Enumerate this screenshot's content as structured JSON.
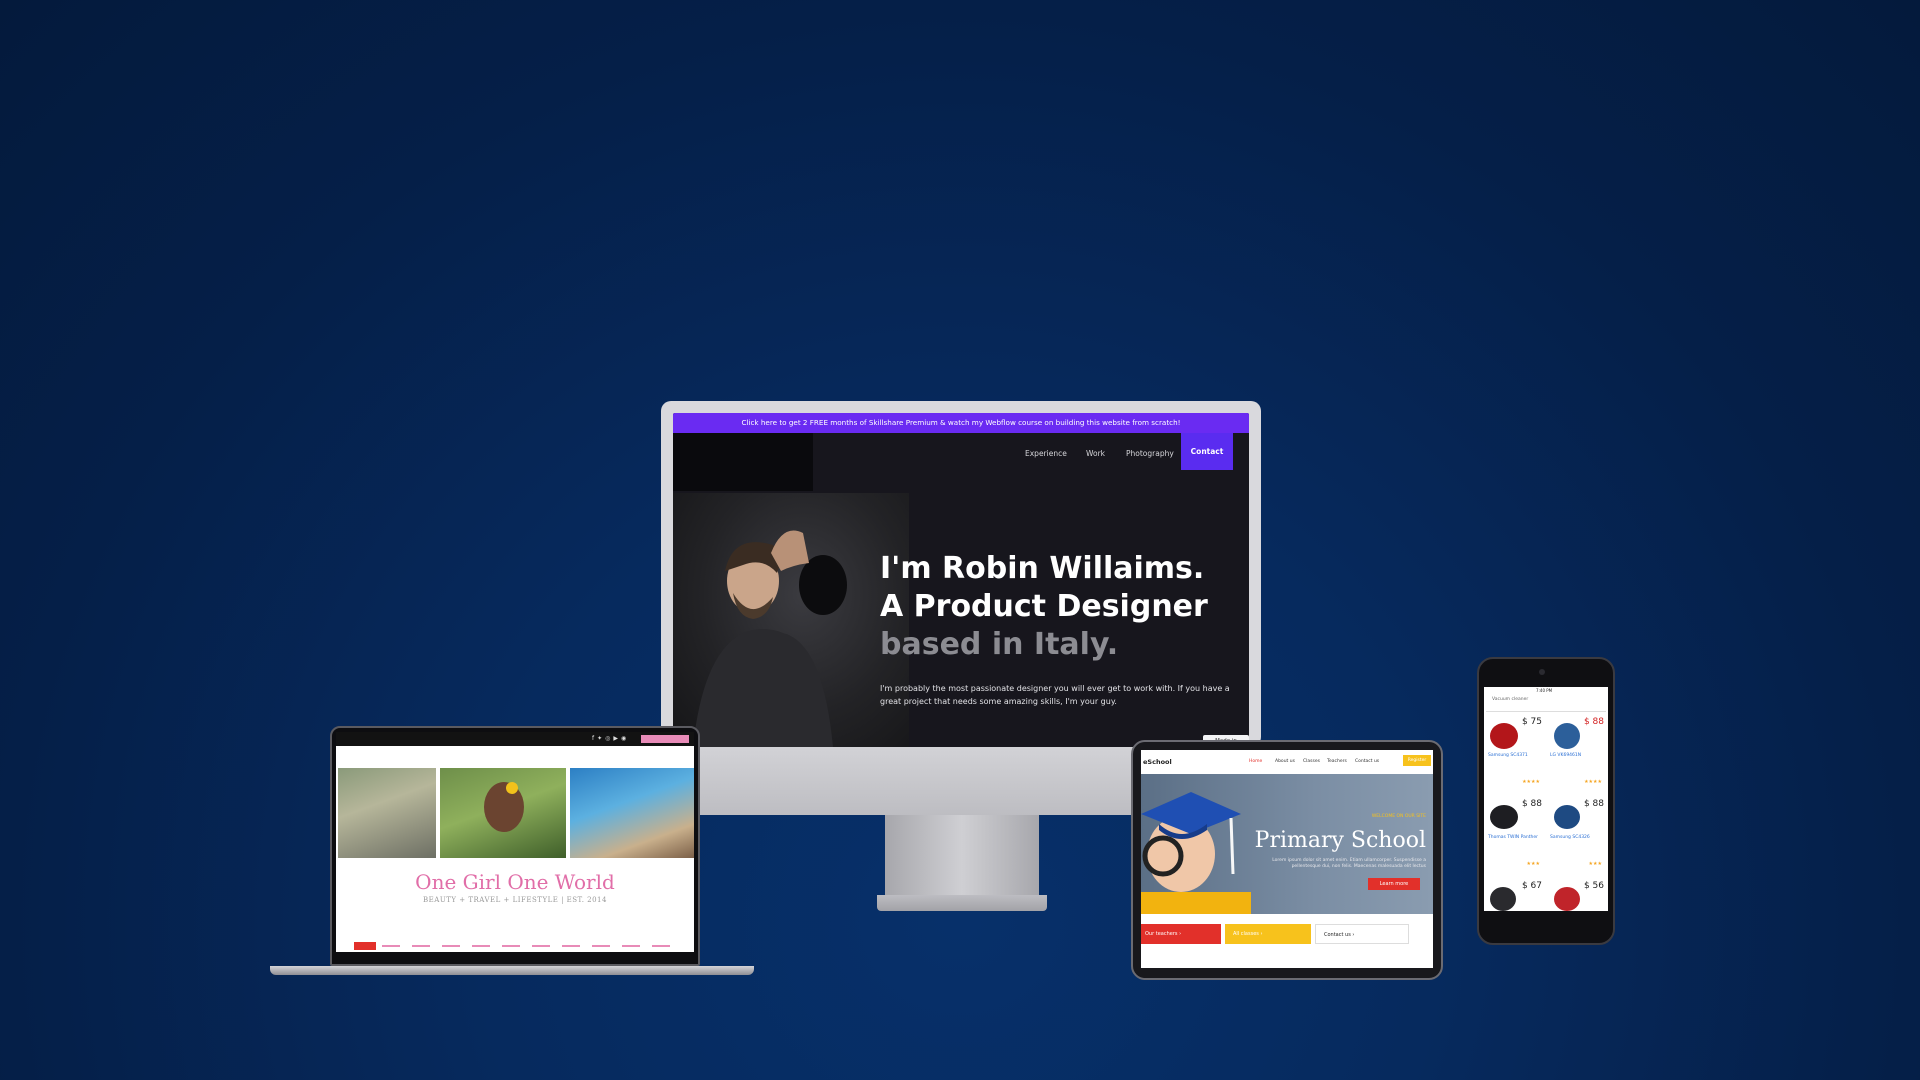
{
  "colors": {
    "background": "#051f48",
    "promo_bar": "#6a2bf2",
    "contact": "#5a2cf0",
    "blog_pink": "#e16ea8",
    "school_red": "#e2302a",
    "school_yellow": "#f7c21c"
  },
  "desktop_site": {
    "promo_banner": "Click here to get 2 FREE months of Skillshare Premium & watch my Webflow course on building this website from scratch!",
    "nav": [
      "Experience",
      "Work",
      "Photography"
    ],
    "contact_label": "Contact",
    "hero_line1": "I'm Robin Willaims.",
    "hero_line2": "A Product Designer",
    "hero_line3": "based in Italy.",
    "bio": "I'm probably the most passionate designer you will ever get to work with. If you have a great project that needs some amazing skills, I'm your guy.",
    "badge": "Made in Webflow"
  },
  "laptop_site": {
    "title": "One Girl One World",
    "subtitle": "BEAUTY + TRAVEL + LIFESTYLE | EST. 2014"
  },
  "tablet_site": {
    "logo": "eSchool",
    "nav": [
      "Home",
      "About us",
      "Classes",
      "Teachers",
      "Contact us"
    ],
    "register": "Register",
    "welcome": "WELCOME ON OUR SITE",
    "title": "Primary School",
    "body": "Lorem ipsum dolor sit amet enim. Etiam ullamcorper. Suspendisse a pellentesque dui, non felis. Maecenas malesuada elit lectus",
    "learn_more": "Learn more",
    "bottom_buttons": [
      "Our teachers",
      "All classes",
      "Contact us"
    ]
  },
  "phone_site": {
    "status_time": "7:40 PM",
    "search": "Vacuum cleaner",
    "products": [
      {
        "price": "$ 75",
        "name": "Samsung SC4371"
      },
      {
        "price": "$ 88",
        "name": "LG VK69461N"
      },
      {
        "price": "$ 88",
        "name": "Thomas TWIN Panther"
      },
      {
        "price": "$ 88",
        "name": "Samsung SC4326"
      },
      {
        "price": "$ 67",
        "name": ""
      },
      {
        "price": "$ 56",
        "name": ""
      }
    ]
  }
}
